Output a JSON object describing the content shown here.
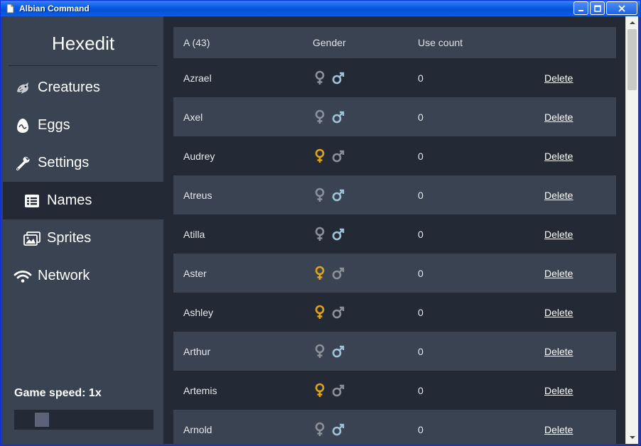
{
  "window": {
    "title": "Albian Command"
  },
  "sidebar": {
    "brand": "Hexedit",
    "items": [
      {
        "label": "Creatures",
        "icon": "creature-icon",
        "level": 1,
        "active": false
      },
      {
        "label": "Eggs",
        "icon": "egg-icon",
        "level": 1,
        "active": false
      },
      {
        "label": "Settings",
        "icon": "wrench-icon",
        "level": 1,
        "active": false
      },
      {
        "label": "Names",
        "icon": "list-icon",
        "level": 2,
        "active": true
      },
      {
        "label": "Sprites",
        "icon": "images-icon",
        "level": 2,
        "active": false
      },
      {
        "label": "Network",
        "icon": "wifi-icon",
        "level": 1,
        "active": false
      }
    ],
    "game_speed_label": "Game speed: 1x",
    "game_speed_fraction": 0.15
  },
  "table": {
    "headers": {
      "name": "A (43)",
      "gender": "Gender",
      "use_count": "Use count"
    },
    "rows": [
      {
        "name": "Azrael",
        "gender": "both",
        "use_count": "0",
        "action": "Delete"
      },
      {
        "name": "Axel",
        "gender": "both",
        "use_count": "0",
        "action": "Delete"
      },
      {
        "name": "Audrey",
        "gender": "female",
        "use_count": "0",
        "action": "Delete"
      },
      {
        "name": "Atreus",
        "gender": "both",
        "use_count": "0",
        "action": "Delete"
      },
      {
        "name": "Atilla",
        "gender": "both",
        "use_count": "0",
        "action": "Delete"
      },
      {
        "name": "Aster",
        "gender": "female",
        "use_count": "0",
        "action": "Delete"
      },
      {
        "name": "Ashley",
        "gender": "female",
        "use_count": "0",
        "action": "Delete"
      },
      {
        "name": "Arthur",
        "gender": "both",
        "use_count": "0",
        "action": "Delete"
      },
      {
        "name": "Artemis",
        "gender": "female",
        "use_count": "0",
        "action": "Delete"
      },
      {
        "name": "Arnold",
        "gender": "both",
        "use_count": "0",
        "action": "Delete"
      }
    ]
  },
  "colors": {
    "female_active": "#e0a317",
    "inactive_gray": "#8a8f98",
    "both_male_blue": "#9fc3d8"
  }
}
